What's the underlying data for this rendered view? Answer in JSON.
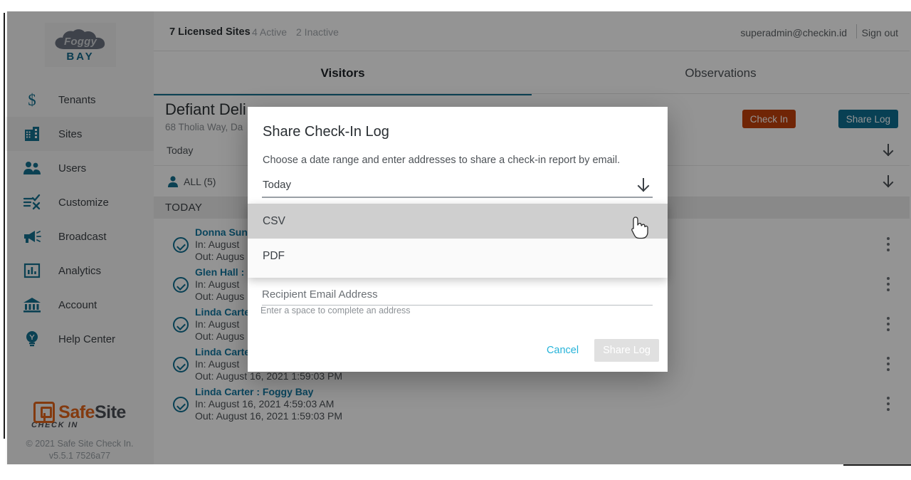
{
  "brand": {
    "logo_foggy": "Foggy",
    "logo_bay": "BAY",
    "safesite_safe": "Safe",
    "safesite_site": "Site",
    "safesite_sub": "CHECK IN",
    "copyright_line1": "© 2021 Safe Site Check In.",
    "copyright_line2": "v5.5.1 7526a77",
    "accent_teal": "#14718f",
    "accent_orange": "#e2641b",
    "link_blue": "#1278a0",
    "cancel_blue": "#26b3d9"
  },
  "sidebar": {
    "items": [
      {
        "label": "Tenants",
        "icon": "dollar-icon",
        "selected": false
      },
      {
        "label": "Sites",
        "icon": "building-icon",
        "selected": true
      },
      {
        "label": "Users",
        "icon": "users-icon",
        "selected": false
      },
      {
        "label": "Customize",
        "icon": "checklist-icon",
        "selected": false
      },
      {
        "label": "Broadcast",
        "icon": "megaphone-icon",
        "selected": false
      },
      {
        "label": "Analytics",
        "icon": "chart-icon",
        "selected": false
      },
      {
        "label": "Account",
        "icon": "bank-icon",
        "selected": false
      },
      {
        "label": "Help Center",
        "icon": "bulb-icon",
        "selected": false
      }
    ]
  },
  "topbar": {
    "licensed_sites": "7 Licensed Sites",
    "active": "4 Active",
    "inactive": "2 Inactive",
    "account_email": "superadmin@checkin.id",
    "sign_out": "Sign out"
  },
  "tabs": [
    {
      "label": "Visitors",
      "active": true
    },
    {
      "label": "Observations",
      "active": false
    }
  ],
  "site": {
    "name": "Defiant Deli",
    "address": "68 Tholia Way, Da",
    "check_in_button": "Check In",
    "share_log_button": "Share Log"
  },
  "filters": {
    "date_range": "Today",
    "people": "ALL (5)",
    "day_header": "TODAY"
  },
  "visitors": [
    {
      "name": "Donna Sun",
      "in": "In: August",
      "out": "Out: Augus"
    },
    {
      "name": "Glen Hall :",
      "in": "In: August",
      "out": "Out: Augus"
    },
    {
      "name": "Linda Carte",
      "in": "In: August",
      "out": "Out: Augus"
    },
    {
      "name": "Linda Carte",
      "in": "In: August",
      "out": "Out: August 16, 2021 1:59:03 PM"
    },
    {
      "name": "Linda Carter : Foggy Bay",
      "in": "In: August 16, 2021 4:59:03 AM",
      "out": "Out: August 16, 2021 1:59:03 PM"
    }
  ],
  "dialog": {
    "title": "Share Check-In Log",
    "description": "Choose a date range and enter addresses to share a check-in report by email.",
    "date_range_value": "Today",
    "email_placeholder": "Recipient Email Address",
    "email_value": "",
    "email_hint": "Enter a space to complete an address",
    "cancel_label": "Cancel",
    "share_label": "Share Log"
  },
  "dropdown": {
    "options": [
      {
        "label": "CSV",
        "highlighted": true
      },
      {
        "label": "PDF",
        "highlighted": false
      }
    ]
  }
}
